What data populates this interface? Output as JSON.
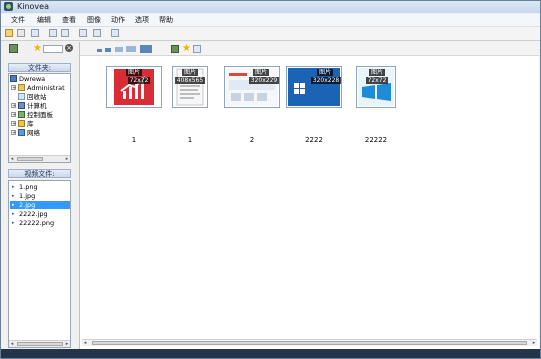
{
  "window": {
    "title": "Kinovea"
  },
  "menu": [
    "文件",
    "编辑",
    "查看",
    "图像",
    "动作",
    "选项",
    "帮助"
  ],
  "left_panel": {
    "folder_header": "文件夹:",
    "tree": [
      {
        "label": "Dwrewa",
        "expander": "−",
        "indent": 0
      },
      {
        "label": "Administrat",
        "expander": "+",
        "indent": 1
      },
      {
        "label": "回收站",
        "expander": "",
        "indent": 1
      },
      {
        "label": "计算机",
        "expander": "+",
        "indent": 1
      },
      {
        "label": "控制面板",
        "expander": "+",
        "indent": 1
      },
      {
        "label": "库",
        "expander": "+",
        "indent": 1
      },
      {
        "label": "网络",
        "expander": "+",
        "indent": 1
      }
    ],
    "video_header": "视频文件:",
    "files": [
      {
        "label": "1.png",
        "selected": false
      },
      {
        "label": "1.jpg",
        "selected": false
      },
      {
        "label": "2.jpg",
        "selected": true
      },
      {
        "label": "2222.jpg",
        "selected": false
      },
      {
        "label": "22222.png",
        "selected": false
      }
    ]
  },
  "thumbnails": [
    {
      "caption": "1",
      "badge_top": "图片",
      "badge_dim": "72x72",
      "style": "red-chart"
    },
    {
      "caption": "1",
      "badge_top": "图片",
      "badge_dim": "408x565",
      "style": "doc"
    },
    {
      "caption": "2",
      "badge_top": "图片",
      "badge_dim": "320x229",
      "style": "web"
    },
    {
      "caption": "2222",
      "badge_top": "图片",
      "badge_dim": "320x228",
      "style": "win-blue"
    },
    {
      "caption": "22222",
      "badge_top": "图片",
      "badge_dim": "72x72",
      "style": "win-logo"
    }
  ],
  "colors": {
    "selection": "#3399ff",
    "statusbar": "#243548"
  }
}
